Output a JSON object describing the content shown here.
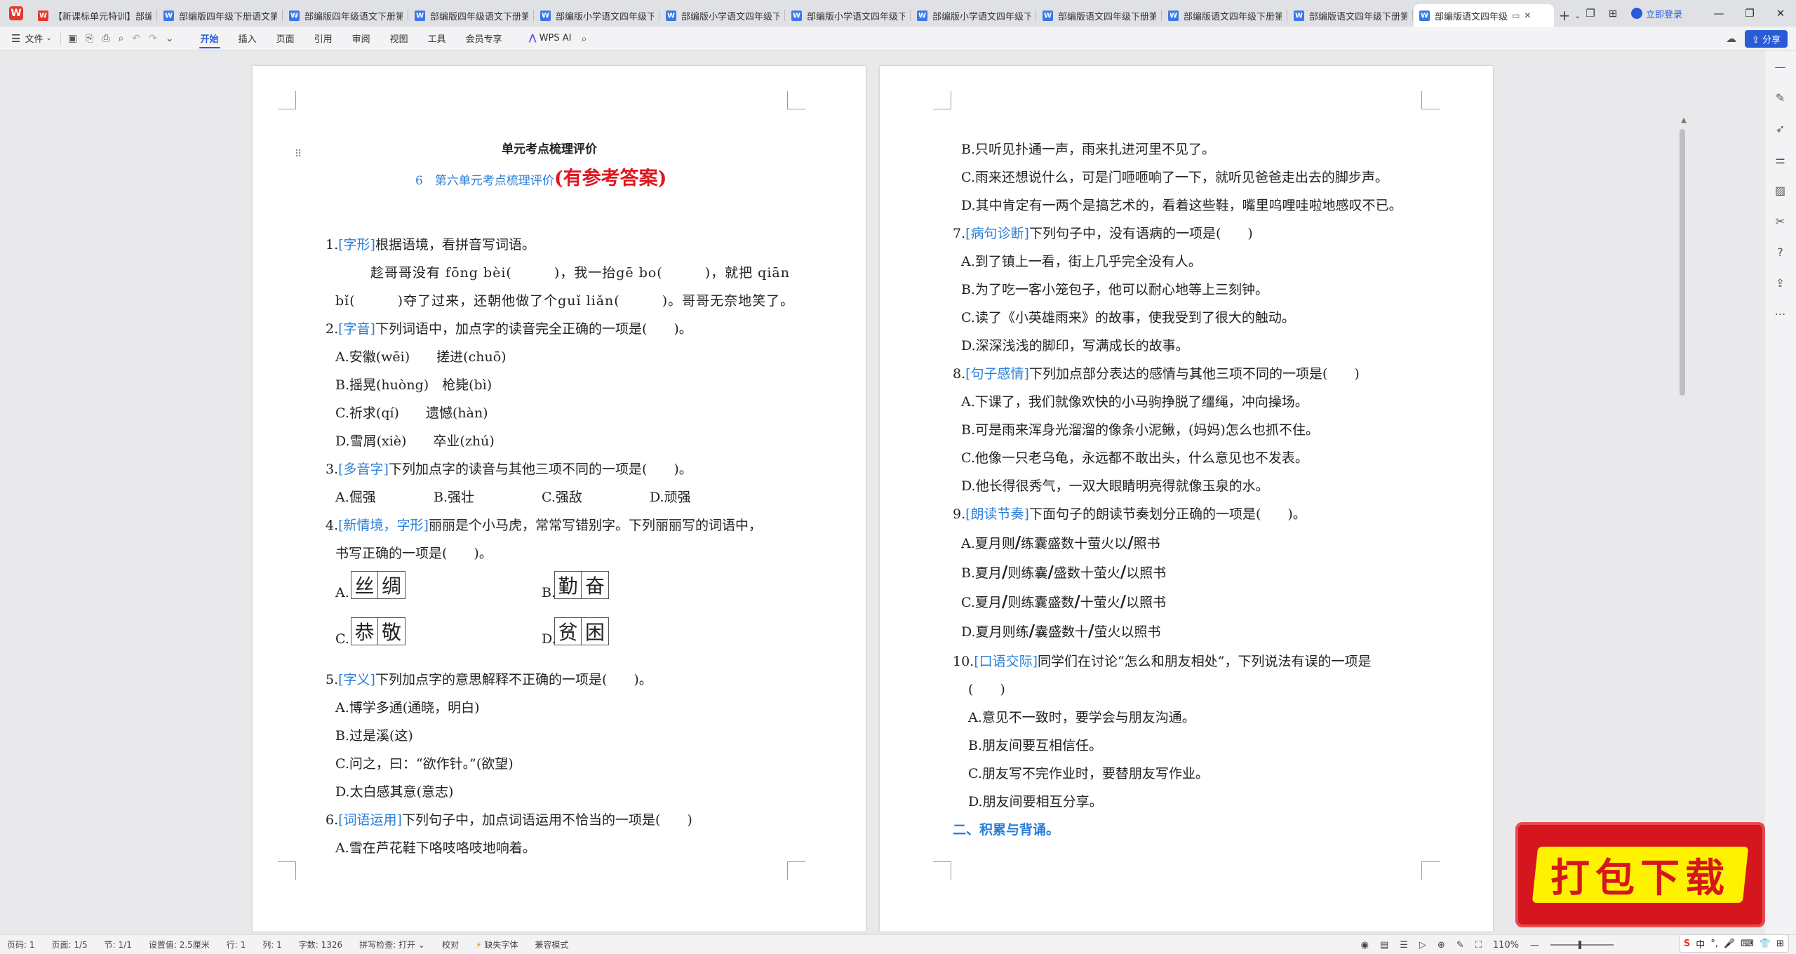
{
  "tabs": [
    {
      "label": "【新课标单元特训】部编",
      "icon": "W"
    },
    {
      "label": "部编版四年级下册语文第",
      "icon": "W"
    },
    {
      "label": "部编版四年级语文下册第",
      "icon": "W"
    },
    {
      "label": "部编版四年级语文下册第",
      "icon": "W"
    },
    {
      "label": "部编版小学语文四年级下",
      "icon": "W"
    },
    {
      "label": "部编版小学语文四年级下",
      "icon": "W"
    },
    {
      "label": "部编版小学语文四年级下",
      "icon": "W"
    },
    {
      "label": "部编版小学语文四年级下",
      "icon": "W"
    },
    {
      "label": "部编版语文四年级下册第",
      "icon": "W"
    },
    {
      "label": "部编版语文四年级下册第",
      "icon": "W"
    },
    {
      "label": "部编版语文四年级下册第",
      "icon": "W"
    }
  ],
  "active_tab": {
    "label": "部编版语文四年级",
    "icon": "W"
  },
  "window": {
    "login": "立即登录"
  },
  "ribbon": {
    "file": "文件",
    "tabs": [
      "开始",
      "插入",
      "页面",
      "引用",
      "审阅",
      "视图",
      "工具",
      "会员专享"
    ],
    "wps_ai": "WPS AI",
    "share": "分享"
  },
  "left_page": {
    "title": "单元考点梳理评价",
    "subtitle": "6　第六单元考点梳理评价",
    "subtitle_red": "(有参考答案)",
    "q1": {
      "num": "1.",
      "tag": "[字形]",
      "text": "根据语境，看拼音写词语。"
    },
    "q1_l1": "趁哥哥没有 fōng bèi(　　　)，我一抬gē bo(　　　)，就把 qiān",
    "q1_l2": "bǐ(　　　)夺了过来，还朝他做了个guǐ liǎn(　　　)。哥哥无奈地笑了。",
    "q2": {
      "num": "2.",
      "tag": "[字音]",
      "text": "下列词语中，加点字的读音完全正确的一项是(　　)。"
    },
    "q2_opts": [
      "A.安徽(wēi)　　搓进(chuō)",
      "B.摇晃(huòng)　枪毙(bì)",
      "C.祈求(qí)　　遗憾(hàn)",
      "D.雪屑(xiè)　　卒业(zhú)"
    ],
    "q3": {
      "num": "3.",
      "tag": "[多音字]",
      "text": "下列加点字的读音与其他三项不同的一项是(　　)。"
    },
    "q3_opts": [
      "A.倔强",
      "B.强壮",
      "C.强敌",
      "D.顽强"
    ],
    "q4": {
      "num": "4.",
      "tag": "[新情境，字形]",
      "text": "丽丽是个小马虎，常常写错别字。下列丽丽写的词语中，"
    },
    "q4_l2": "书写正确的一项是(　　)。",
    "q4_opts": [
      {
        "letter": "A.",
        "chars": [
          "丝",
          "绸"
        ]
      },
      {
        "letter": "B.",
        "chars": [
          "勤",
          "奋"
        ]
      },
      {
        "letter": "C.",
        "chars": [
          "恭",
          "敬"
        ]
      },
      {
        "letter": "D.",
        "chars": [
          "贫",
          "困"
        ]
      }
    ],
    "q5": {
      "num": "5.",
      "tag": "[字义]",
      "text": "下列加点字的意思解释不正确的一项是(　　)。"
    },
    "q5_opts": [
      "A.博学多通(通晓，明白)",
      "B.过是溪(这)",
      "C.问之，曰：“欲作针。”(欲望)",
      "D.太白感其意(意志)"
    ],
    "q6": {
      "num": "6.",
      "tag": "[词语运用]",
      "text": "下列句子中，加点词语运用不恰当的一项是(　　)"
    },
    "q6_a": "A.雪在芦花鞋下咯吱咯吱地响着。"
  },
  "right_page": {
    "q6_rest": [
      "B.只听见扑通一声，雨来扎进河里不见了。",
      "C.雨来还想说什么，可是门咂咂响了一下，就听见爸爸走出去的脚步声。",
      "D.其中肯定有一两个是搞艺术的，看着这些鞋，嘴里呜哩哇啦地感叹不已。"
    ],
    "q7": {
      "num": "7.",
      "tag": "[病句诊断]",
      "text": "下列句子中，没有语病的一项是(　　)"
    },
    "q7_opts": [
      "A.到了镇上一看，街上几乎完全没有人。",
      "B.为了吃一客小笼包子，他可以耐心地等上三刻钟。",
      "C.读了《小英雄雨来》的故事，使我受到了很大的触动。",
      "D.深深浅浅的脚印，写满成长的故事。"
    ],
    "q8": {
      "num": "8.",
      "tag": "[句子感情]",
      "text": "下列加点部分表达的感情与其他三项不同的一项是(　　)"
    },
    "q8_opts": [
      "A.下课了，我们就像欢快的小马驹挣脱了缰绳，冲向操场。",
      "B.可是雨来浑身光溜溜的像条小泥鳅，(妈妈)怎么也抓不住。",
      "C.他像一只老乌龟，永远都不敢出头，什么意见也不发表。",
      "D.他长得很秀气，一双大眼睛明亮得就像玉泉的水。"
    ],
    "q9": {
      "num": "9.",
      "tag": "[朗读节奏]",
      "text": "下面句子的朗读节奏划分正确的一项是(　　)。"
    },
    "q9_opts": [
      {
        "parts": [
          "A.夏月则",
          "练囊盛数十萤火以",
          "照书"
        ]
      },
      {
        "parts": [
          "B.夏月",
          "则练囊",
          "盛数十萤火",
          "以照书"
        ]
      },
      {
        "parts": [
          "C.夏月",
          "则练囊盛数",
          "十萤火",
          "以照书"
        ]
      },
      {
        "parts": [
          "D.夏月则练",
          "囊盛数十",
          "萤火以照书"
        ]
      }
    ],
    "q10": {
      "num": "10.",
      "tag": "[口语交际]",
      "text": "同学们在讨论“怎么和朋友相处”，下列说法有误的一项是"
    },
    "q10_l2": "(　　)",
    "q10_opts": [
      "A.意见不一致时，要学会与朋友沟通。",
      "B.朋友间要互相信任。",
      "C.朋友写不完作业时，要替朋友写作业。",
      "D.朋友间要相互分享。"
    ],
    "section": "二、积累与背诵。"
  },
  "statusbar": {
    "page": "页码: 1",
    "pages": "页面: 1/5",
    "section": "节: 1/1",
    "setting": "设置值: 2.5厘米",
    "row": "行: 1",
    "col": "列: 1",
    "words": "字数: 1326",
    "spell": "拼写检查: 打开",
    "proof": "校对",
    "missing_font": "缺失字体",
    "compat": "兼容模式",
    "zoom": "110%"
  },
  "ime": {
    "lang": "中"
  },
  "banner": {
    "text": "打包下载"
  }
}
